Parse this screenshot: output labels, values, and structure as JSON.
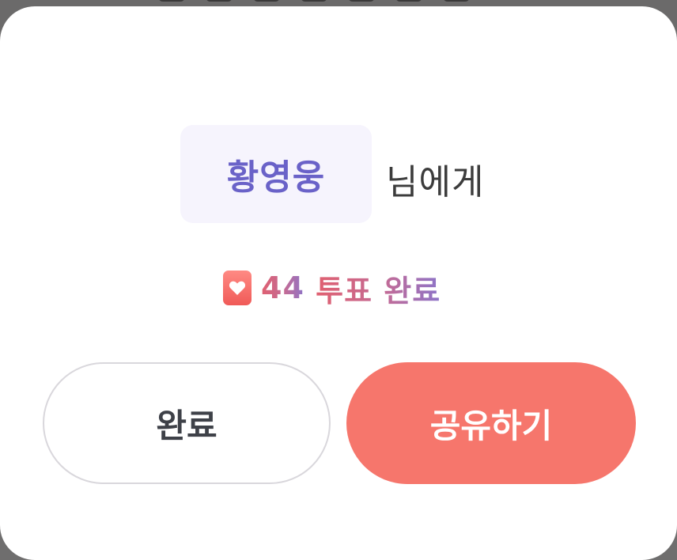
{
  "modal": {
    "recipient_name": "황영웅",
    "recipient_suffix": "님에게",
    "vote_count": "44",
    "vote_label": "투표 완료"
  },
  "buttons": {
    "done_label": "완료",
    "share_label": "공유하기"
  },
  "colors": {
    "accent_purple": "#6a62c8",
    "share_button": "#f6766c",
    "heart_badge": "#f05a58"
  },
  "icons": {
    "vote_badge": "heart-icon"
  }
}
